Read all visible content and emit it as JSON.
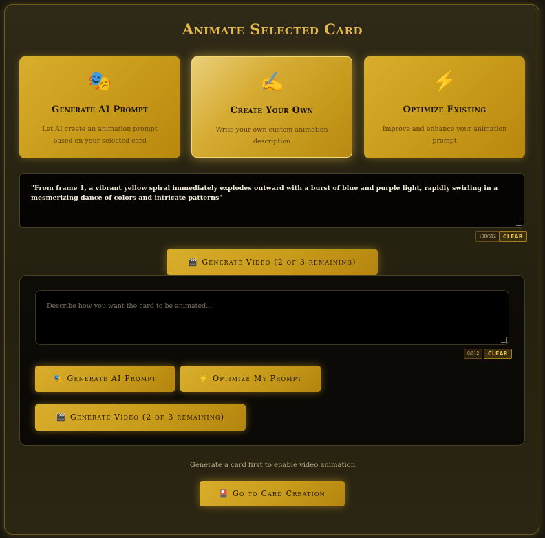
{
  "title": "Animate Selected Card",
  "cards": [
    {
      "icon": "🎭",
      "icon_name": "theater-masks-icon",
      "title": "Generate AI Prompt",
      "desc": "Let AI create an animation prompt based on your selected card"
    },
    {
      "icon": "✍️",
      "icon_name": "writing-hand-icon",
      "title": "Create Your Own",
      "desc": "Write your own custom animation description"
    },
    {
      "icon": "⚡",
      "icon_name": "lightning-icon",
      "title": "Optimize Existing",
      "desc": "Improve and enhance your animation prompt"
    }
  ],
  "prompt": {
    "value": "\"From frame 1, a vibrant yellow spiral immediately explodes outward with a burst of blue and purple light, rapidly swirling in a mesmerizing dance of colors and intricate patterns\"",
    "counter": "180/512",
    "clear_label": "CLEAR"
  },
  "generate_video_label": "Generate Video (2 of 3 remaining)",
  "generate_video_icon": "🎬",
  "custom": {
    "placeholder": "Describe how you want the card to be animated...",
    "counter": "0/512",
    "clear_label": "CLEAR",
    "ai_prompt_icon": "🎭",
    "ai_prompt_label": "Generate AI Prompt",
    "optimize_icon": "⚡",
    "optimize_label": "Optimize My Prompt",
    "video_icon": "🎬",
    "video_label": "Generate Video (2 of 3 remaining)"
  },
  "footer": {
    "message": "Generate a card first to enable video animation",
    "go_icon": "🎴",
    "go_label": "Go to Card Creation"
  },
  "colors": {
    "accent": "#d4a82a",
    "title": "#e2b84a",
    "background": "#24200f"
  }
}
